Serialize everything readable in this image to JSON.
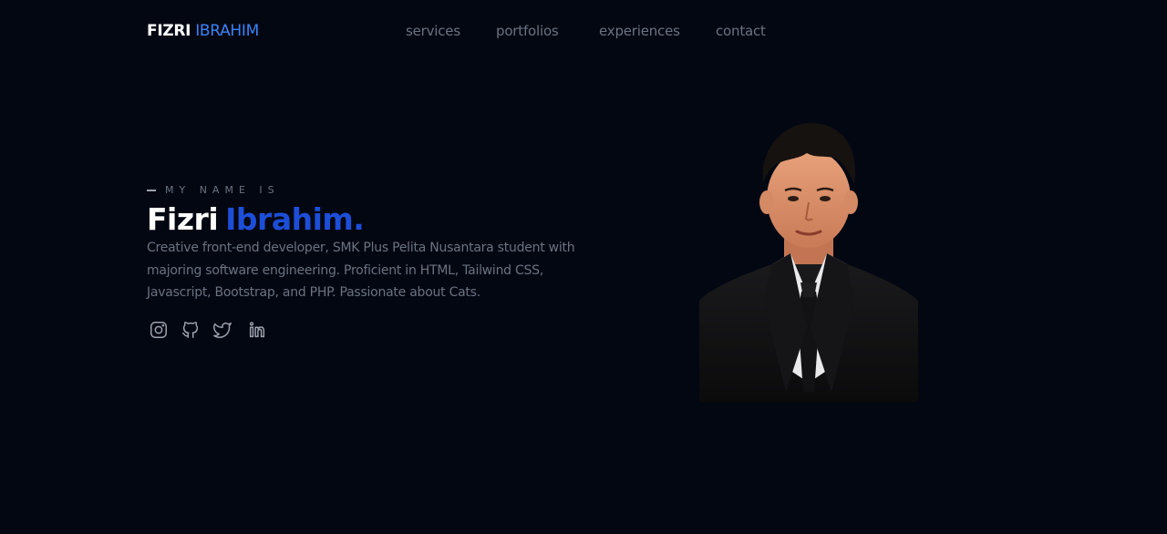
{
  "header": {
    "logo_first": "FIZRI",
    "logo_last": "IBRAHIM",
    "nav": [
      "services",
      "portfolios",
      "experiences",
      "contact"
    ]
  },
  "hero": {
    "eyebrow": "MY NAME IS",
    "name_first": "Fizri",
    "name_last": "Ibrahim.",
    "bio": "Creative front-end developer, SMK Plus Pelita Nusantara student with majoring software engineering. Proficient in HTML, Tailwind CSS, Javascript, Bootstrap, and PHP. Passionate about Cats.",
    "socials": [
      {
        "icon": "instagram-icon"
      },
      {
        "icon": "github-icon"
      },
      {
        "icon": "twitter-icon"
      },
      {
        "icon": "linkedin-icon"
      }
    ]
  },
  "colors": {
    "background": "#030712",
    "accent": "#1d4ed8",
    "logo_accent": "#3b82f6",
    "muted_text": "#6b7280"
  }
}
